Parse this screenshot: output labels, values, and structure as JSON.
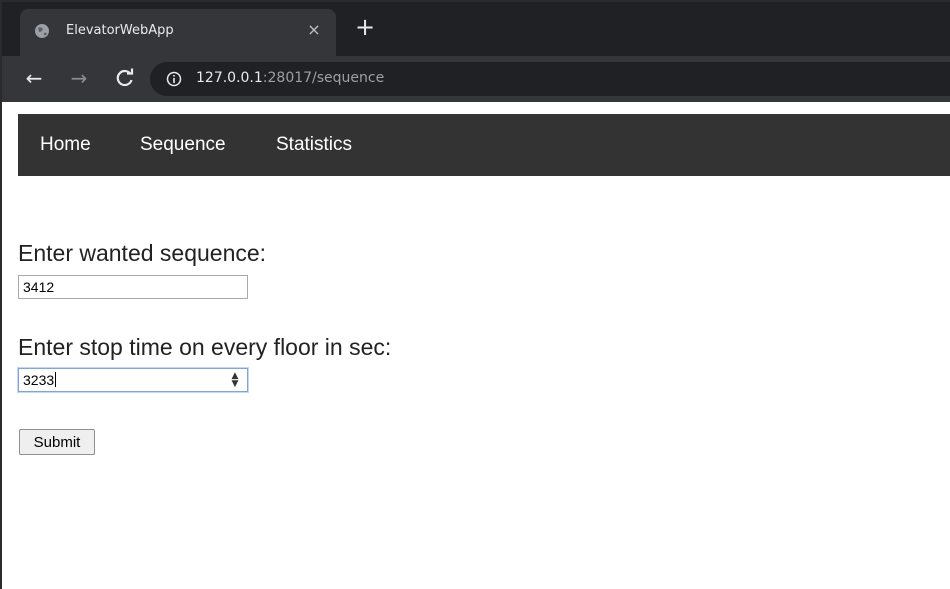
{
  "browser": {
    "tab_title": "ElevatorWebApp",
    "tab_close": "×",
    "new_tab": "+",
    "url_host": "127.0.0.1",
    "url_rest": ":28017/sequence",
    "back_icon": "←",
    "forward_icon": "→",
    "reload_icon": "C"
  },
  "nav": {
    "items": [
      {
        "label": "Home"
      },
      {
        "label": "Sequence"
      },
      {
        "label": "Statistics"
      }
    ]
  },
  "form": {
    "sequence_label": "Enter wanted sequence:",
    "sequence_value": "3412",
    "stop_label": "Enter stop time on every floor in sec:",
    "stop_value": "3233",
    "submit_label": "Submit"
  },
  "colors": {
    "tab_strip": "#202124",
    "toolbar": "#35363a",
    "navbar": "#333333"
  }
}
